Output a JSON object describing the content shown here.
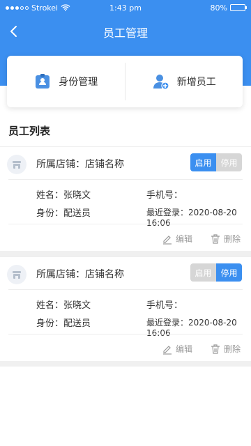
{
  "status_bar": {
    "carrier": "Strokei",
    "time": "1:43 pm",
    "battery": "80%",
    "battery_level": 0.8
  },
  "navbar": {
    "title": "员工管理",
    "back_icon": "chevron-left-icon"
  },
  "top_actions": [
    {
      "label": "身份管理",
      "icon": "id-badge-icon"
    },
    {
      "label": "新增员工",
      "icon": "add-user-icon"
    }
  ],
  "section": {
    "title": "员工列表"
  },
  "colors": {
    "primary": "#3b8ff0",
    "toggle_off": "#d6d6d6",
    "muted": "#999999"
  },
  "employees": [
    {
      "store": "所属店铺：店铺名称",
      "toggle": {
        "enable": "启用",
        "disable": "停用",
        "active": "enable"
      },
      "name": "姓名：张晓文",
      "phone": "手机号：",
      "role": "身份：配送员",
      "last_login": "最近登录：2020-08-20  16:06",
      "edit": "编辑",
      "delete": "删除"
    },
    {
      "store": "所属店铺：店铺名称",
      "toggle": {
        "enable": "启用",
        "disable": "停用",
        "active": "disable"
      },
      "name": "姓名：张晓文",
      "phone": "手机号：",
      "role": "身份：配送员",
      "last_login": "最近登录：2020-08-20  16:06",
      "edit": "编辑",
      "delete": "删除"
    }
  ]
}
